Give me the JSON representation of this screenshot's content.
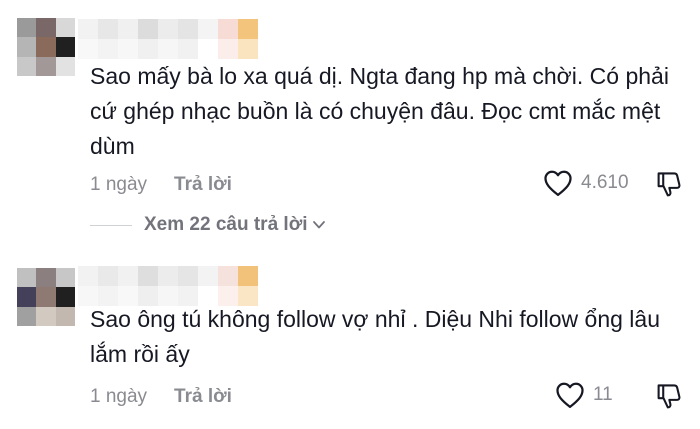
{
  "comments": [
    {
      "text": "Sao mấy bà lo xa quá dị. Ngta đang hp mà chời. Có phải cứ ghép nhạc buồn là có chuyện đâu. Đọc cmt mắc mệt dùm",
      "time": "1 ngày",
      "reply_label": "Trả lời",
      "likes": "4.610",
      "view_replies": "Xem 22 câu trả lời"
    },
    {
      "text": "Sao ông tú không follow vợ nhỉ . Diệu Nhi follow ổng lâu lắm rồi ấy",
      "time": "1 ngày",
      "reply_label": "Trả lời",
      "likes": "11"
    }
  ],
  "icons": {
    "like": "heart-outline-icon",
    "dislike": "thumbs-down-outline-icon",
    "chevron": "chevron-down-icon"
  },
  "colors": {
    "text": "#161823",
    "muted": "#8a8b91",
    "icon": "#161823"
  }
}
